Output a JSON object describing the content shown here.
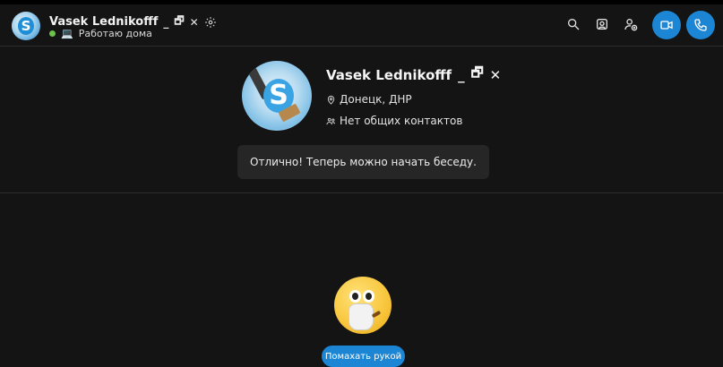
{
  "header": {
    "name": "Vasek Lednikofff",
    "title_glyphs": [
      "_",
      "🗗",
      "✕"
    ],
    "status_icon": "💻",
    "status": "Работаю дома",
    "status_color": "#6cc24a",
    "icons": [
      "search-icon",
      "gallery-icon",
      "add-person-icon",
      "video-call-icon",
      "audio-call-icon"
    ]
  },
  "profile": {
    "name": "Vasek Lednikofff",
    "name_glyphs": [
      "_",
      "🗗",
      "✕"
    ],
    "location": "Донецк, ДНР",
    "contacts": "Нет общих контактов"
  },
  "notice": "Отлично! Теперь можно начать беседу.",
  "wave_button": "Помахать рукой",
  "colors": {
    "accent": "#1c86d4",
    "background": "#141414",
    "card": "#262626"
  }
}
